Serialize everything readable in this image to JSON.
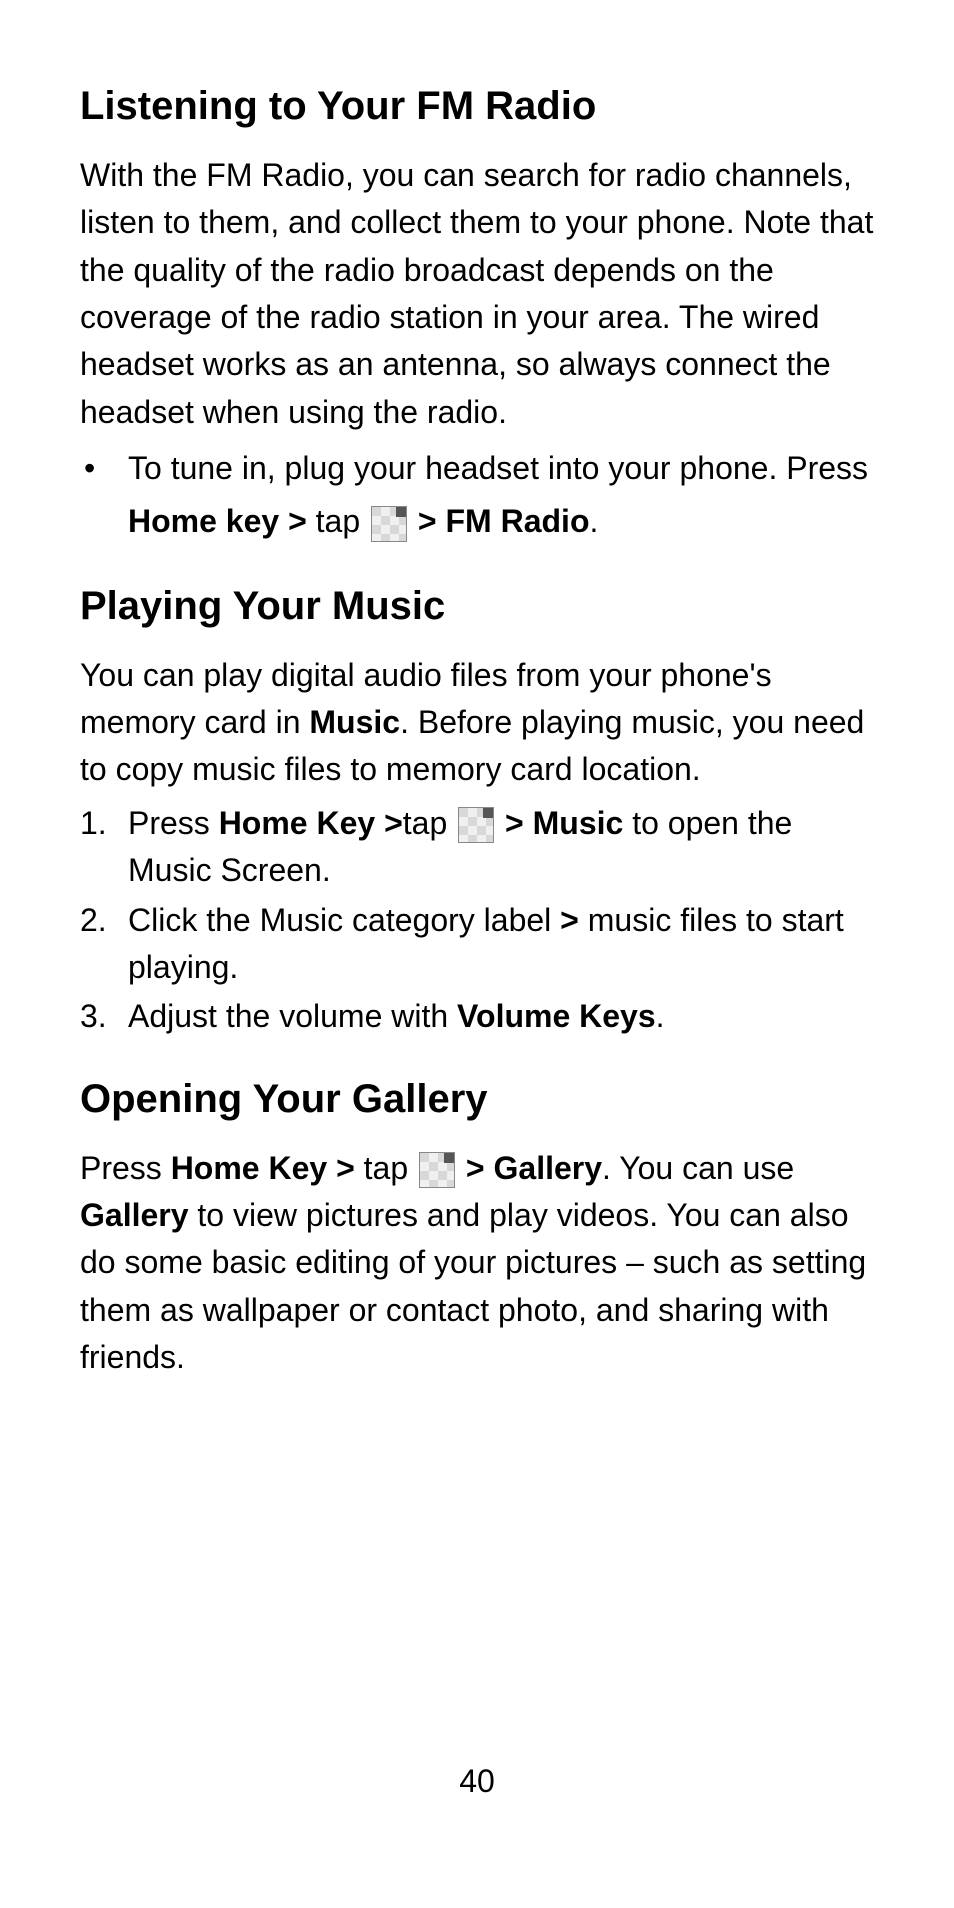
{
  "sections": {
    "fm_radio": {
      "heading": "Listening to Your FM Radio",
      "intro": "With the FM Radio, you can search for radio channels, listen to them, and collect them to your phone. Note that the quality of the radio broadcast depends on the coverage of the radio station in your area. The wired headset works as an antenna, so always connect the headset when using the radio.",
      "bullet": {
        "pre": "To tune in, plug your headset into your phone. Press ",
        "home_key": "Home key > ",
        "tap": "tap ",
        "post_icon": " > FM Radio",
        "period": "."
      }
    },
    "music": {
      "heading": "Playing Your Music",
      "intro_pre": "You can play digital audio files from your phone's memory card in ",
      "intro_bold": "Music",
      "intro_post": ". Before playing music, you need to copy music files to memory card location.",
      "steps": {
        "s1": {
          "pre": "Press ",
          "home_key": "Home Key >",
          "tap": "tap ",
          "post_icon": " > Music",
          "tail": " to open the Music Screen."
        },
        "s2": {
          "pre": "Click the Music category label ",
          "gt": ">",
          "tail": " music files to start playing."
        },
        "s3": {
          "pre": "Adjust the volume with ",
          "bold": "Volume Keys",
          "tail": "."
        }
      }
    },
    "gallery": {
      "heading": "Opening Your Gallery",
      "p": {
        "pre": "Press ",
        "home_key": "Home Key > ",
        "tap": "tap ",
        "post_icon": " > Gallery",
        "mid": ". You can use ",
        "gallery_bold": "Gallery",
        "tail": " to view pictures and play videos. You can also do some basic editing of your pictures – such as setting them as wallpaper or contact photo, and sharing with friends."
      }
    }
  },
  "page_number": "40"
}
